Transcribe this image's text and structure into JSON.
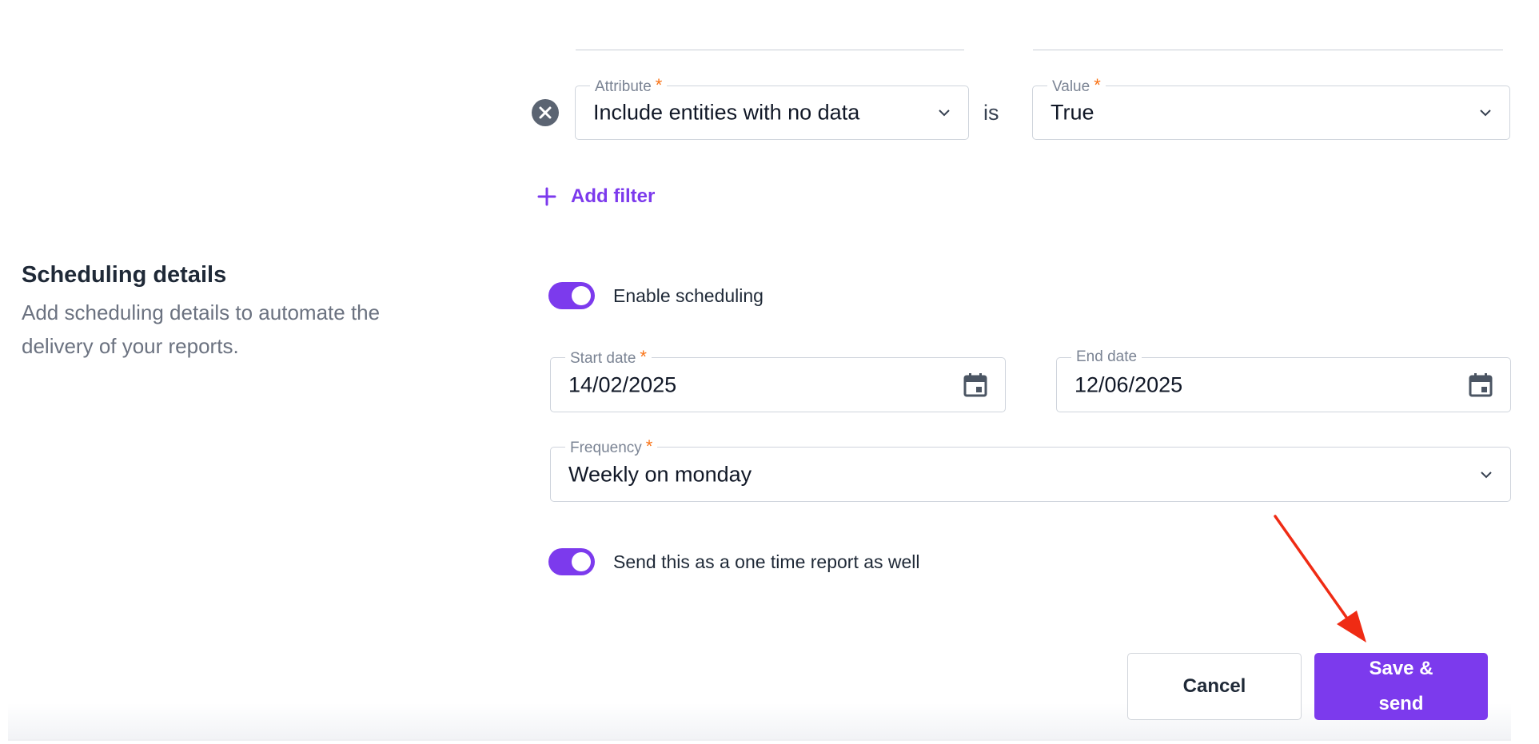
{
  "filter": {
    "attribute_label": "Attribute",
    "attribute_value": "Include entities with no data",
    "operator_text": "is",
    "value_label": "Value",
    "value_value": "True",
    "required_mark": "*",
    "add_filter_label": "Add filter"
  },
  "scheduling": {
    "title": "Scheduling details",
    "description": "Add scheduling details to automate the delivery of your reports.",
    "enable_label": "Enable scheduling",
    "enable_on": true,
    "start_date_label": "Start date",
    "start_date_value": "14/02/2025",
    "end_date_label": "End date",
    "end_date_value": "12/06/2025",
    "frequency_label": "Frequency",
    "frequency_value": "Weekly on monday",
    "one_time_label": "Send this as a one time report as well",
    "one_time_on": true
  },
  "actions": {
    "cancel_label": "Cancel",
    "save_label": "Save & send"
  },
  "colors": {
    "accent": "#7c3aed",
    "required": "#f97316",
    "annotation_arrow": "#ef2b14"
  },
  "icons": [
    "close-circle-icon",
    "chevron-down-icon",
    "plus-icon",
    "calendar-icon",
    "arrow-annotation-icon"
  ]
}
